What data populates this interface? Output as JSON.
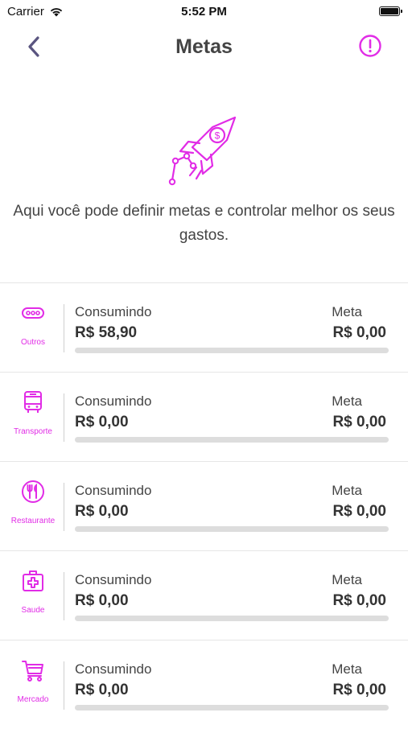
{
  "status_bar": {
    "carrier": "Carrier",
    "time": "5:52 PM"
  },
  "nav": {
    "title": "Metas"
  },
  "hero": {
    "text": "Aqui você pode definir metas e controlar melhor os seus gastos."
  },
  "accent_color": "#e12ce6",
  "icons": {
    "back": "chevron-left-icon",
    "info": "exclamation-circle-icon",
    "hero": "rocket-dollar-icon"
  },
  "categories": [
    {
      "name": "Outros",
      "icon": "dots-icon",
      "consumed_label": "Consumindo",
      "consumed": "R$  58,90",
      "meta_label": "Meta",
      "meta": "R$  0,00",
      "progress": 0
    },
    {
      "name": "Transporte",
      "icon": "bus-icon",
      "consumed_label": "Consumindo",
      "consumed": "R$  0,00",
      "meta_label": "Meta",
      "meta": "R$  0,00",
      "progress": 0
    },
    {
      "name": "Restaurante",
      "icon": "cutlery-icon",
      "consumed_label": "Consumindo",
      "consumed": "R$  0,00",
      "meta_label": "Meta",
      "meta": "R$  0,00",
      "progress": 0
    },
    {
      "name": "Saude",
      "icon": "medical-kit-icon",
      "consumed_label": "Consumindo",
      "consumed": "R$  0,00",
      "meta_label": "Meta",
      "meta": "R$  0,00",
      "progress": 0
    },
    {
      "name": "Mercado",
      "icon": "cart-icon",
      "consumed_label": "Consumindo",
      "consumed": "R$  0,00",
      "meta_label": "Meta",
      "meta": "R$  0,00",
      "progress": 0
    }
  ]
}
